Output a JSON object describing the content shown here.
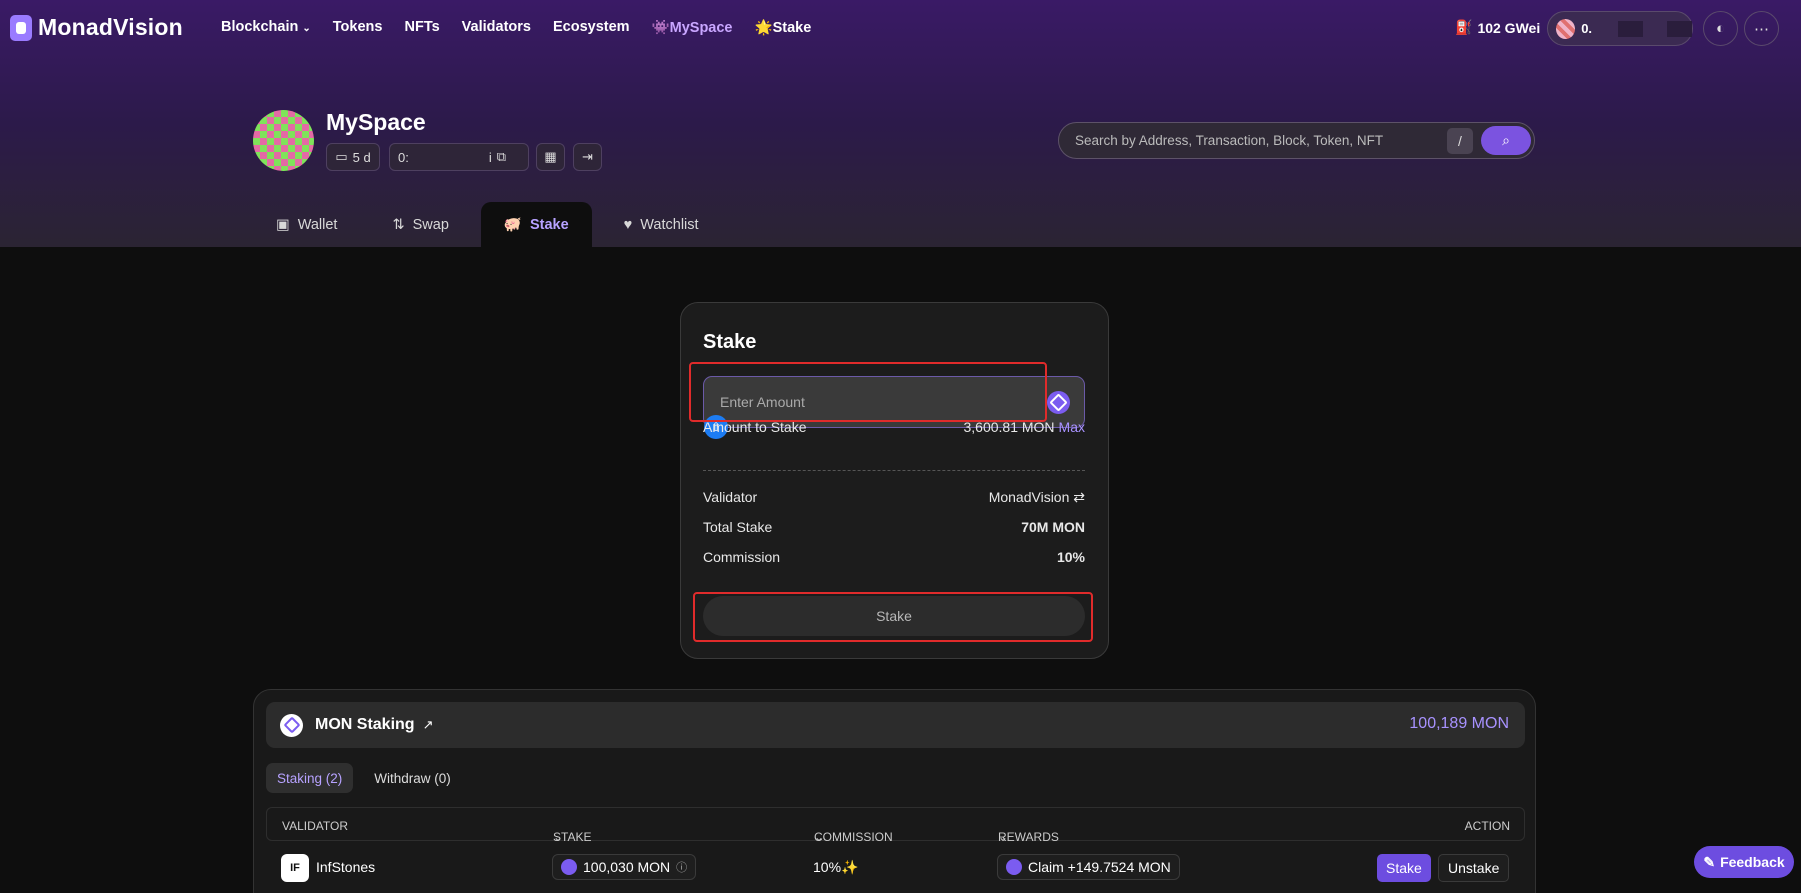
{
  "brand": {
    "name": "MonadVision"
  },
  "nav": {
    "items": [
      "Blockchain",
      "Tokens",
      "NFTs",
      "Validators",
      "Ecosystem",
      "MySpace",
      "Stake"
    ],
    "blockchain_chevron": "chevron-down-icon"
  },
  "header": {
    "gas": "102 GWei",
    "account_prefix": "0."
  },
  "profile": {
    "title": "MySpace",
    "age": "5 d",
    "address_prefix": "0:",
    "address_suffix": "i"
  },
  "search": {
    "placeholder": "Search by Address, Transaction, Block, Token, NFT",
    "shortcut": "/"
  },
  "tabs": [
    "Wallet",
    "Swap",
    "Stake",
    "Watchlist"
  ],
  "active_tab": "Stake",
  "stake_card": {
    "title": "Stake",
    "amount_placeholder": "Enter Amount",
    "amount_to_stake_label": "Amount to Stake",
    "amount_to_stake_value": "3,600.81 MON",
    "max_label": "Max",
    "validator_label": "Validator",
    "validator_value": "MonadVision",
    "total_stake_label": "Total Stake",
    "total_stake_value": "70M MON",
    "commission_label": "Commission",
    "commission_value": "10%",
    "button_label": "Stake"
  },
  "staking_panel": {
    "title": "MON Staking",
    "total": "100,189 MON",
    "subtabs": [
      "Staking (2)",
      "Withdraw (0)"
    ],
    "columns": [
      "VALIDATOR",
      "STAKE",
      "COMMISSION",
      "REWARDS",
      "ACTION"
    ],
    "rows": [
      {
        "validator": "InfStones",
        "logo_text": "IF",
        "stake": "100,030 MON",
        "commission": "10%✨",
        "rewards": "Claim +149.7524 MON",
        "actions": [
          "Stake",
          "Unstake"
        ]
      }
    ]
  },
  "feedback": {
    "label": "Feedback"
  },
  "colors": {
    "accent": "#7b53e0",
    "highlight": "#e02b2b",
    "link": "#a892ff"
  }
}
